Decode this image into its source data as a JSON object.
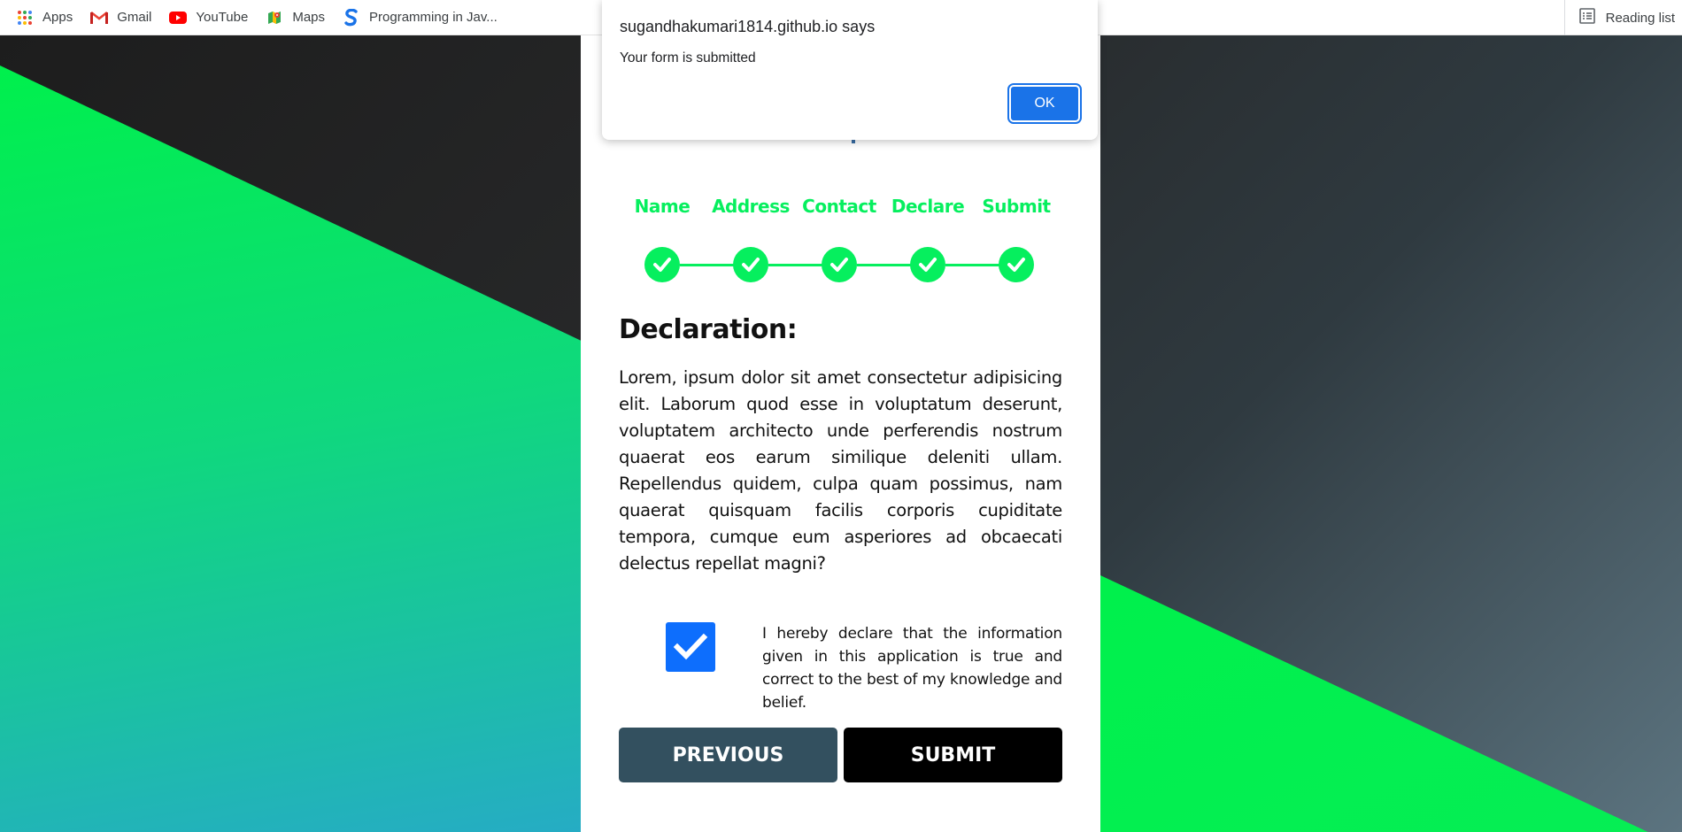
{
  "bookmarks": {
    "items": [
      {
        "label": "Apps",
        "icon": "apps-grid-icon"
      },
      {
        "label": "Gmail",
        "icon": "gmail-icon"
      },
      {
        "label": "YouTube",
        "icon": "youtube-icon"
      },
      {
        "label": "Maps",
        "icon": "maps-icon"
      },
      {
        "label": "Programming in Jav...",
        "icon": "s-logo-icon"
      }
    ],
    "reading_list": "Reading list"
  },
  "dialog": {
    "origin": "sugandhakumari1814.github.io says",
    "message": "Your form is submitted",
    "ok_label": "OK"
  },
  "stepper": {
    "steps": [
      {
        "label": "Name",
        "complete": true
      },
      {
        "label": "Address",
        "complete": true
      },
      {
        "label": "Contact",
        "complete": true
      },
      {
        "label": "Declare",
        "complete": true
      },
      {
        "label": "Submit",
        "complete": true
      }
    ]
  },
  "declaration": {
    "heading": "Declaration:",
    "body": "Lorem, ipsum dolor sit amet consectetur adipisicing elit. Laborum quod esse in voluptatum deserunt, voluptatem architecto unde perferendis nostrum quaerat eos earum similique deleniti ullam. Repellendus quidem, culpa quam possimus, nam quaerat quisquam facilis corporis cupiditate tempora, cumque eum asperiores ad obcaecati delectus repellat magni?",
    "checkbox_checked": true,
    "checkbox_text": "I hereby declare that the information given in this application is true and correct to the best of my knowledge and belief."
  },
  "buttons": {
    "previous": "PREVIOUS",
    "submit": "SUBMIT"
  },
  "colors": {
    "accent_green": "#06ef5e",
    "checkbox_blue": "#0d6efd",
    "previous_button": "#33505f",
    "submit_button": "#000000",
    "dialog_ok": "#1a73e8"
  }
}
